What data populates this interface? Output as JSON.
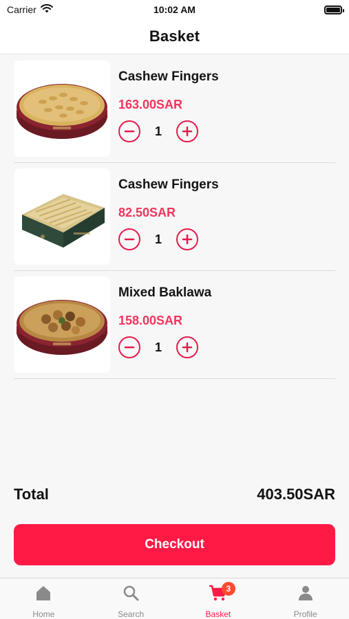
{
  "status": {
    "carrier": "Carrier",
    "time": "10:02 AM"
  },
  "nav": {
    "title": "Basket"
  },
  "items": [
    {
      "name": "Cashew Fingers",
      "price": "163.00SAR",
      "qty": "1"
    },
    {
      "name": "Cashew Fingers",
      "price": "82.50SAR",
      "qty": "1"
    },
    {
      "name": "Mixed Baklawa",
      "price": "158.00SAR",
      "qty": "1"
    }
  ],
  "total": {
    "label": "Total",
    "value": "403.50SAR"
  },
  "checkout": {
    "label": "Checkout"
  },
  "tabs": [
    {
      "label": "Home",
      "icon": "home-icon"
    },
    {
      "label": "Search",
      "icon": "search-icon"
    },
    {
      "label": "Basket",
      "icon": "cart-icon",
      "badge": "3"
    },
    {
      "label": "Profile",
      "icon": "person-icon"
    }
  ],
  "colors": {
    "accent": "#ff1a46",
    "price": "#f2335c",
    "badge": "#ff4a2e"
  }
}
